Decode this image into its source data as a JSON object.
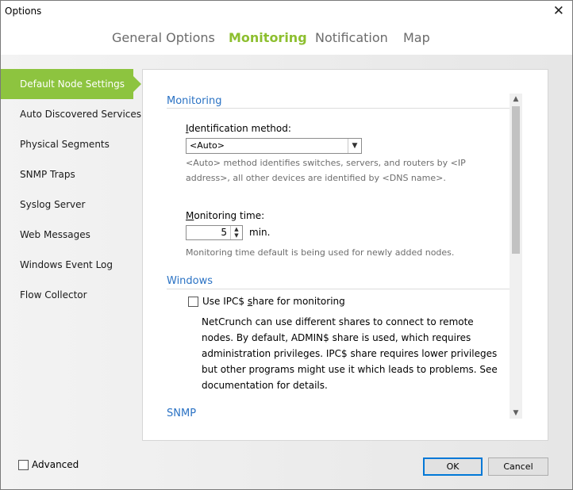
{
  "window": {
    "title": "Options",
    "close_glyph": "✕"
  },
  "tabs": [
    {
      "label": "General Options",
      "active": false
    },
    {
      "label": "Monitoring",
      "active": true
    },
    {
      "label": "Notification",
      "active": false
    },
    {
      "label": "Map",
      "active": false
    }
  ],
  "sidebar": {
    "items": [
      {
        "label": "Default Node Settings",
        "active": true
      },
      {
        "label": "Auto Discovered Services"
      },
      {
        "label": "Physical Segments"
      },
      {
        "label": "SNMP Traps"
      },
      {
        "label": "Syslog Server"
      },
      {
        "label": "Web Messages"
      },
      {
        "label": "Windows Event Log"
      },
      {
        "label": "Flow Collector"
      }
    ]
  },
  "monitoring": {
    "section_title": "Monitoring",
    "identification_label_prefix": "I",
    "identification_label_rest": "dentification method:",
    "identification_value": "<Auto>",
    "identification_hint_line1": "<Auto> method identifies switches, servers, and routers by <IP",
    "identification_hint_line2": "address>, all other devices are identified by <DNS name>.",
    "monitoring_time_label_prefix": "M",
    "monitoring_time_label_rest": "onitoring time:",
    "monitoring_time_value": "5",
    "monitoring_time_unit": "min.",
    "monitoring_time_hint": "Monitoring time default is being used for newly added nodes."
  },
  "windows": {
    "section_title": "Windows",
    "ipc_checkbox_prefix": "Use IPC$ ",
    "ipc_checkbox_underlined": "s",
    "ipc_checkbox_rest": "hare for monitoring",
    "ipc_checked": false,
    "ipc_description": "NetCrunch can use different shares to connect to remote nodes. By default, ADMIN$ share is used, which requires administration privileges. IPC$ share requires lower privileges but other programs might use it which leads to problems. See documentation for details."
  },
  "snmp": {
    "section_title": "SNMP"
  },
  "footer": {
    "advanced_label": "Advanced",
    "advanced_checked": false,
    "ok_label": "OK",
    "cancel_label": "Cancel"
  },
  "colors": {
    "accent_green": "#8dc43f",
    "section_blue": "#2a72c4",
    "default_button_border": "#0078d7"
  },
  "icons": {
    "select_arrow": "chevron-down-icon",
    "spin_up": "caret-up-icon",
    "spin_down": "caret-down-icon",
    "scroll_up": "chevron-up-icon",
    "scroll_down": "chevron-down-icon"
  }
}
